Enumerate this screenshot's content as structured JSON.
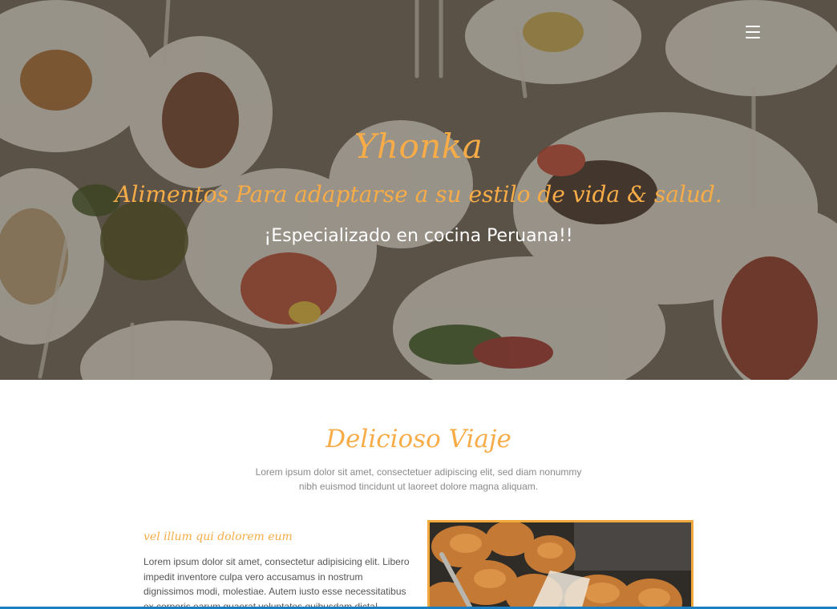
{
  "hero": {
    "title": "Yhonka",
    "tagline": "Alimentos Para adaptarse a su estilo de vida & salud.",
    "subtitle": "¡Especializado en cocina Peruana!!",
    "menu_icon": "hamburger-menu-icon"
  },
  "section": {
    "title": "Delicioso Viaje",
    "description": "Lorem ipsum dolor sit amet, consectetuer adipiscing elit, sed diam nonummy nibh euismod tincidunt ut laoreet dolore magna aliquam."
  },
  "feature": {
    "heading": "vel illum qui dolorem eum",
    "text": "Lorem ipsum dolor sit amet, consectetur adipisicing elit. Libero impedit inventore culpa vero accusamus in nostrum dignissimos modi, molestiae. Autem iusto esse necessitatibus ex corporis earum quaerat voluptates quibusdam dicta!"
  },
  "colors": {
    "accent": "#f7ac47",
    "frame": "#f2a93b",
    "text_muted": "#8a8a8a",
    "bottom_bar": "#1b7fc4"
  }
}
